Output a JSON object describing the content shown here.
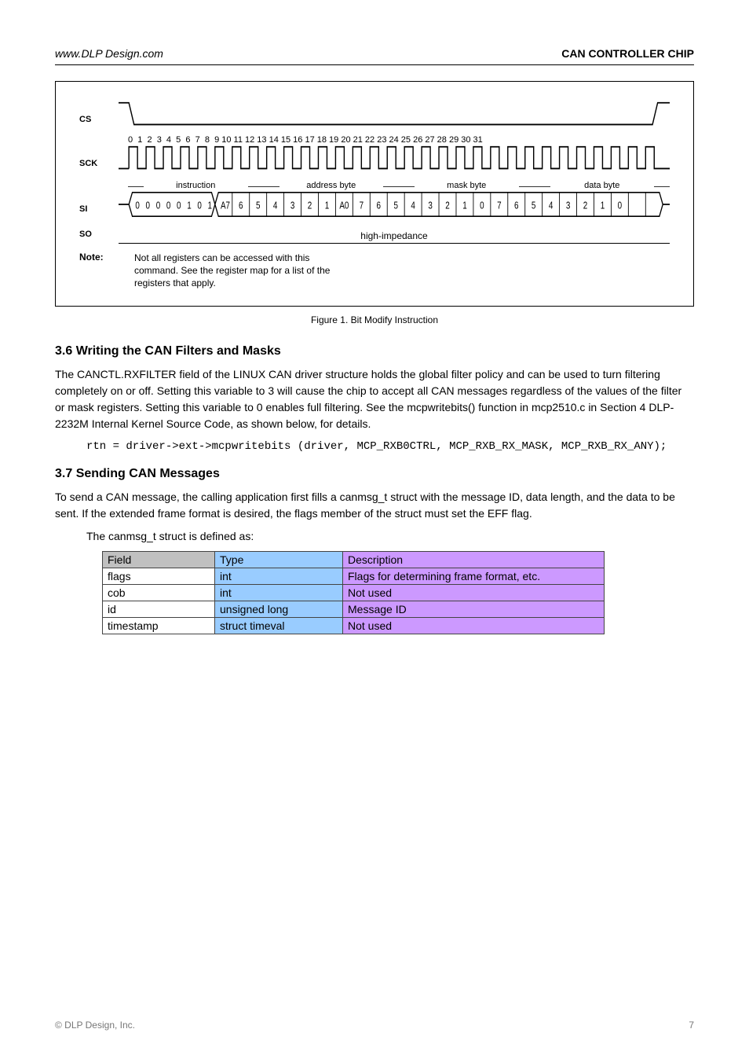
{
  "header": {
    "left_text": "www.DLP Design.com",
    "right_text": "CAN CONTROLLER CHIP"
  },
  "figure": {
    "signals": {
      "cs": "CS",
      "sck": "SCK",
      "si": "SI",
      "so": "SO"
    },
    "sck_numbers": "0  1  2  3  4  5  6  7  8  9 10 11 12 13 14 15 16 17 18 19 20 21 22 23 24 25 26 27 28 29 30 31",
    "byte_labels": {
      "instruction": "instruction",
      "address": "address byte",
      "mask": "mask byte",
      "data": "data byte"
    },
    "si_instruction_bits": [
      "0",
      "0",
      "0",
      "0",
      "0",
      "1",
      "0",
      "1"
    ],
    "si_address_bits": [
      "A7",
      "6",
      "5",
      "4",
      "3",
      "2",
      "1",
      "A0"
    ],
    "si_mask_bits": [
      "7",
      "6",
      "5",
      "4",
      "3",
      "2",
      "1",
      "0"
    ],
    "si_data_bits": [
      "7",
      "6",
      "5",
      "4",
      "3",
      "2",
      "1",
      "0"
    ],
    "so_text": "high-impedance",
    "note_label": "Note:",
    "note_text": "Not all registers can be accessed with this command. See the register map for a list of the registers that apply.",
    "caption": "Figure 1. Bit Modify Instruction"
  },
  "section6": {
    "title": "3.6 Writing the CAN Filters and Masks",
    "para": "The CANCTL.RXFILTER field of the LINUX CAN driver structure holds the global filter policy and can be used to turn filtering completely on or off.  Setting this variable to 3 will cause the chip to accept all CAN messages regardless of the values of the filter or mask registers.  Setting this variable to 0 enables full filtering.  See the mcpwritebits() function in mcp2510.c in Section 4 DLP-2232M Internal Kernel Source Code, as shown below, for details.",
    "sig": "rtn = driver->ext->mcpwritebits (driver, MCP_RXB0CTRL, MCP_RXB_RX_MASK, MCP_RXB_RX_ANY);"
  },
  "section7": {
    "title": "3.7 Sending CAN Messages",
    "para": "To send a CAN message, the calling application first fills a canmsg_t struct with the message ID, data length, and the data to be sent.  If the extended frame format is desired, the flags member of the struct must set the EFF flag.",
    "struct_intro": "The canmsg_t struct is defined as:",
    "table": {
      "headers": {
        "field": "Field",
        "type": "Type",
        "desc": "Description"
      },
      "rows": [
        {
          "field": "flags",
          "type": "int",
          "desc": "Flags for determining frame format, etc."
        },
        {
          "field": "cob",
          "type": "int",
          "desc": "Not used"
        },
        {
          "field": "id",
          "type": "unsigned long",
          "desc": "Message ID"
        },
        {
          "field": "timestamp",
          "type": "struct timeval",
          "desc": "Not used"
        }
      ]
    }
  },
  "footer": {
    "left": "© DLP Design, Inc.",
    "right": "7"
  }
}
